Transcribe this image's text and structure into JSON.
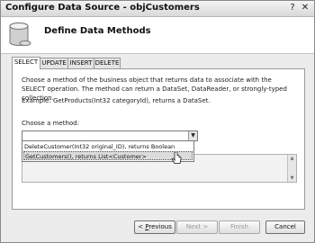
{
  "window": {
    "title": "Configure Data Source - objCustomers"
  },
  "header": {
    "title": "Define Data Methods",
    "icon": "database-icon"
  },
  "tabs": [
    {
      "label": "SELECT"
    },
    {
      "label": "UPDATE"
    },
    {
      "label": "INSERT"
    },
    {
      "label": "DELETE"
    }
  ],
  "select_tab": {
    "description": "Choose a method of the business object that returns data to associate with the SELECT operation. The method can return a DataSet, DataReader, or strongly-typed collection.",
    "example": "Example: GetProducts(Int32 categoryId), returns a DataSet.",
    "choose_label": "Choose a method:",
    "method_options": [
      "DeleteCustomer(Int32 original_ID), returns Boolean",
      "GetCustomers(), returns List<Customer>"
    ]
  },
  "buttons": {
    "previous_accel": "P",
    "previous_rest": "revious",
    "next": "Next >",
    "finish": "Finish",
    "cancel": "Cancel"
  }
}
